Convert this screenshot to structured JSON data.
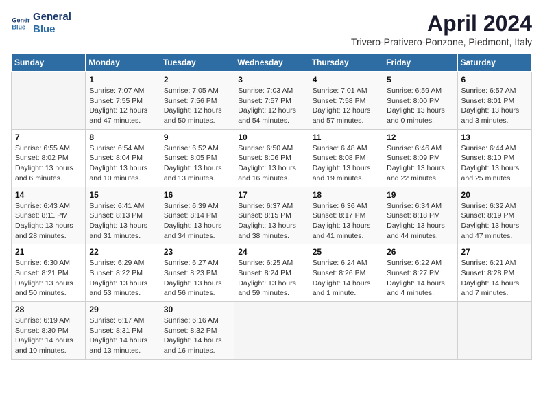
{
  "logo": {
    "line1": "General",
    "line2": "Blue"
  },
  "title": "April 2024",
  "location": "Trivero-Prativero-Ponzone, Piedmont, Italy",
  "weekdays": [
    "Sunday",
    "Monday",
    "Tuesday",
    "Wednesday",
    "Thursday",
    "Friday",
    "Saturday"
  ],
  "weeks": [
    [
      {
        "day": "",
        "sunrise": "",
        "sunset": "",
        "daylight": ""
      },
      {
        "day": "1",
        "sunrise": "Sunrise: 7:07 AM",
        "sunset": "Sunset: 7:55 PM",
        "daylight": "Daylight: 12 hours and 47 minutes."
      },
      {
        "day": "2",
        "sunrise": "Sunrise: 7:05 AM",
        "sunset": "Sunset: 7:56 PM",
        "daylight": "Daylight: 12 hours and 50 minutes."
      },
      {
        "day": "3",
        "sunrise": "Sunrise: 7:03 AM",
        "sunset": "Sunset: 7:57 PM",
        "daylight": "Daylight: 12 hours and 54 minutes."
      },
      {
        "day": "4",
        "sunrise": "Sunrise: 7:01 AM",
        "sunset": "Sunset: 7:58 PM",
        "daylight": "Daylight: 12 hours and 57 minutes."
      },
      {
        "day": "5",
        "sunrise": "Sunrise: 6:59 AM",
        "sunset": "Sunset: 8:00 PM",
        "daylight": "Daylight: 13 hours and 0 minutes."
      },
      {
        "day": "6",
        "sunrise": "Sunrise: 6:57 AM",
        "sunset": "Sunset: 8:01 PM",
        "daylight": "Daylight: 13 hours and 3 minutes."
      }
    ],
    [
      {
        "day": "7",
        "sunrise": "Sunrise: 6:55 AM",
        "sunset": "Sunset: 8:02 PM",
        "daylight": "Daylight: 13 hours and 6 minutes."
      },
      {
        "day": "8",
        "sunrise": "Sunrise: 6:54 AM",
        "sunset": "Sunset: 8:04 PM",
        "daylight": "Daylight: 13 hours and 10 minutes."
      },
      {
        "day": "9",
        "sunrise": "Sunrise: 6:52 AM",
        "sunset": "Sunset: 8:05 PM",
        "daylight": "Daylight: 13 hours and 13 minutes."
      },
      {
        "day": "10",
        "sunrise": "Sunrise: 6:50 AM",
        "sunset": "Sunset: 8:06 PM",
        "daylight": "Daylight: 13 hours and 16 minutes."
      },
      {
        "day": "11",
        "sunrise": "Sunrise: 6:48 AM",
        "sunset": "Sunset: 8:08 PM",
        "daylight": "Daylight: 13 hours and 19 minutes."
      },
      {
        "day": "12",
        "sunrise": "Sunrise: 6:46 AM",
        "sunset": "Sunset: 8:09 PM",
        "daylight": "Daylight: 13 hours and 22 minutes."
      },
      {
        "day": "13",
        "sunrise": "Sunrise: 6:44 AM",
        "sunset": "Sunset: 8:10 PM",
        "daylight": "Daylight: 13 hours and 25 minutes."
      }
    ],
    [
      {
        "day": "14",
        "sunrise": "Sunrise: 6:43 AM",
        "sunset": "Sunset: 8:11 PM",
        "daylight": "Daylight: 13 hours and 28 minutes."
      },
      {
        "day": "15",
        "sunrise": "Sunrise: 6:41 AM",
        "sunset": "Sunset: 8:13 PM",
        "daylight": "Daylight: 13 hours and 31 minutes."
      },
      {
        "day": "16",
        "sunrise": "Sunrise: 6:39 AM",
        "sunset": "Sunset: 8:14 PM",
        "daylight": "Daylight: 13 hours and 34 minutes."
      },
      {
        "day": "17",
        "sunrise": "Sunrise: 6:37 AM",
        "sunset": "Sunset: 8:15 PM",
        "daylight": "Daylight: 13 hours and 38 minutes."
      },
      {
        "day": "18",
        "sunrise": "Sunrise: 6:36 AM",
        "sunset": "Sunset: 8:17 PM",
        "daylight": "Daylight: 13 hours and 41 minutes."
      },
      {
        "day": "19",
        "sunrise": "Sunrise: 6:34 AM",
        "sunset": "Sunset: 8:18 PM",
        "daylight": "Daylight: 13 hours and 44 minutes."
      },
      {
        "day": "20",
        "sunrise": "Sunrise: 6:32 AM",
        "sunset": "Sunset: 8:19 PM",
        "daylight": "Daylight: 13 hours and 47 minutes."
      }
    ],
    [
      {
        "day": "21",
        "sunrise": "Sunrise: 6:30 AM",
        "sunset": "Sunset: 8:21 PM",
        "daylight": "Daylight: 13 hours and 50 minutes."
      },
      {
        "day": "22",
        "sunrise": "Sunrise: 6:29 AM",
        "sunset": "Sunset: 8:22 PM",
        "daylight": "Daylight: 13 hours and 53 minutes."
      },
      {
        "day": "23",
        "sunrise": "Sunrise: 6:27 AM",
        "sunset": "Sunset: 8:23 PM",
        "daylight": "Daylight: 13 hours and 56 minutes."
      },
      {
        "day": "24",
        "sunrise": "Sunrise: 6:25 AM",
        "sunset": "Sunset: 8:24 PM",
        "daylight": "Daylight: 13 hours and 59 minutes."
      },
      {
        "day": "25",
        "sunrise": "Sunrise: 6:24 AM",
        "sunset": "Sunset: 8:26 PM",
        "daylight": "Daylight: 14 hours and 1 minute."
      },
      {
        "day": "26",
        "sunrise": "Sunrise: 6:22 AM",
        "sunset": "Sunset: 8:27 PM",
        "daylight": "Daylight: 14 hours and 4 minutes."
      },
      {
        "day": "27",
        "sunrise": "Sunrise: 6:21 AM",
        "sunset": "Sunset: 8:28 PM",
        "daylight": "Daylight: 14 hours and 7 minutes."
      }
    ],
    [
      {
        "day": "28",
        "sunrise": "Sunrise: 6:19 AM",
        "sunset": "Sunset: 8:30 PM",
        "daylight": "Daylight: 14 hours and 10 minutes."
      },
      {
        "day": "29",
        "sunrise": "Sunrise: 6:17 AM",
        "sunset": "Sunset: 8:31 PM",
        "daylight": "Daylight: 14 hours and 13 minutes."
      },
      {
        "day": "30",
        "sunrise": "Sunrise: 6:16 AM",
        "sunset": "Sunset: 8:32 PM",
        "daylight": "Daylight: 14 hours and 16 minutes."
      },
      {
        "day": "",
        "sunrise": "",
        "sunset": "",
        "daylight": ""
      },
      {
        "day": "",
        "sunrise": "",
        "sunset": "",
        "daylight": ""
      },
      {
        "day": "",
        "sunrise": "",
        "sunset": "",
        "daylight": ""
      },
      {
        "day": "",
        "sunrise": "",
        "sunset": "",
        "daylight": ""
      }
    ]
  ]
}
